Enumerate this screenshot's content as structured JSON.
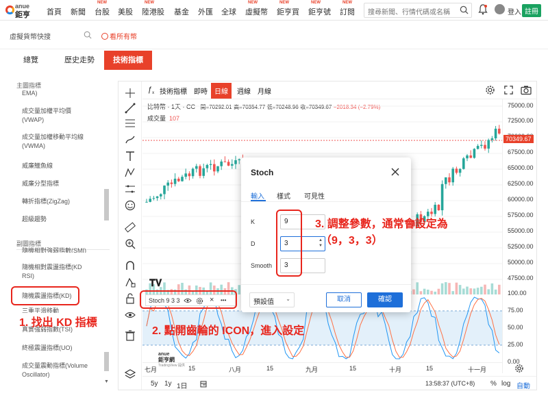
{
  "logo": {
    "top": "anue",
    "bottom": "鉅亨"
  },
  "nav": [
    {
      "label": "首頁",
      "new": ""
    },
    {
      "label": "新聞",
      "new": ""
    },
    {
      "label": "台股",
      "new": "NEW"
    },
    {
      "label": "美股",
      "new": ""
    },
    {
      "label": "陸港股",
      "new": "NEW"
    },
    {
      "label": "基金",
      "new": ""
    },
    {
      "label": "外匯",
      "new": ""
    },
    {
      "label": "全球",
      "new": ""
    },
    {
      "label": "虛擬幣",
      "new": "NEW"
    },
    {
      "label": "鉅亨買",
      "new": "NEW"
    },
    {
      "label": "鉅亨號",
      "new": "NEW"
    },
    {
      "label": "訂閱",
      "new": "NEW"
    }
  ],
  "search": {
    "placeholder": "搜尋新聞、行情代碼或名稱"
  },
  "user": {
    "login": "登入",
    "register": "註冊"
  },
  "subbar": {
    "symbol_placeholder": "虛擬貨幣快搜",
    "view_all": "看所有幣"
  },
  "tabs": [
    "總覽",
    "歷史走勢",
    "技術指標"
  ],
  "left": {
    "main_section": "主圖指標",
    "main_items": [
      "EMA)",
      "成交量加權平均價\n(VWAP)",
      "成交量加權移動平均線\n(VWMA)",
      "威廉鱷魚線",
      "威廉分型指標",
      "轉折指標(ZigZag)",
      "超級趨勢"
    ],
    "sub_section": "副圖指標",
    "sub_items": [
      "隨機相對強弱指數(SMI)",
      "隨機相對震盪指標(KD\nRSI)",
      "隨機震盪指標(KD)",
      "三重平滑移動",
      "真實強弱指數(TSI)",
      "終極震盪指標(UO)",
      "成交量震動指標(Volume\nOscillator)"
    ]
  },
  "toolbar": {
    "tech": "技術指標",
    "items": [
      "即時",
      "日線",
      "週線",
      "月線"
    ]
  },
  "legend": {
    "name": "比特幣",
    "interval": "1天",
    "exch": "CC",
    "open": "開=70292.01",
    "high": "高=70354.77",
    "low": "低=70248.96",
    "close": "收=70349.67",
    "change": "−2018.34 (−2.79%)"
  },
  "volume": {
    "label": "成交量",
    "value": "107"
  },
  "yaxis": [
    "75000.00",
    "72500.00",
    "70000.00",
    "67500.00",
    "65000.00",
    "62500.00",
    "60000.00",
    "57500.00",
    "55000.00",
    "52500.00",
    "50000.00",
    "47500.00",
    "100.00",
    "75.00",
    "50.00",
    "25.00",
    "0.00"
  ],
  "price_tag": "70349.67",
  "stoch_legend": {
    "label": "Stoch 9 3 3",
    "more": "•••"
  },
  "watermark": {
    "line1": "anue",
    "line2": "鉅亨網",
    "line3": "TradingView 提供"
  },
  "xaxis": [
    "七月",
    "15",
    "八月",
    "15",
    "九月",
    "15",
    "十月",
    "15",
    "十一月"
  ],
  "bottom": {
    "ranges": [
      "5y",
      "1y",
      "1日"
    ],
    "time": "13:58:37 (UTC+8)",
    "pct": "%",
    "log": "log",
    "auto": "自動"
  },
  "dialog": {
    "title": "Stoch",
    "tabs": [
      "輸入",
      "樣式",
      "可見性"
    ],
    "fields": [
      {
        "label": "K",
        "value": "9"
      },
      {
        "label": "D",
        "value": "3"
      },
      {
        "label": "Smooth",
        "value": "3"
      }
    ],
    "default": "預設值",
    "cancel": "取消",
    "ok": "確認"
  },
  "annotations": {
    "a1": "1. 找出 KD 指標",
    "a2": "2. 點開齒輪的 ICON，進入設定",
    "a3_line1": "3. 調整參數，通常會設定為",
    "a3_line2": "（9，3，3）"
  },
  "colors": {
    "accent": "#e8412a",
    "up": "#26a69a",
    "down": "#ef5350",
    "blue": "#1e6fd9",
    "annotation": "#e8251c"
  }
}
